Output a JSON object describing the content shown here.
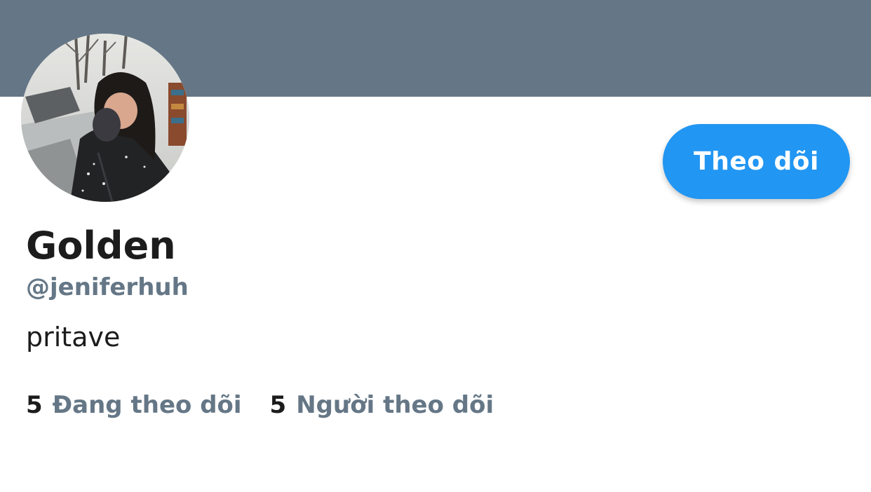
{
  "profile": {
    "display_name": "Golden",
    "handle": "@jeniferhuh",
    "bio": "pritave",
    "follow_label": "Theo dõi"
  },
  "stats": {
    "following_count": "5",
    "following_label": "Đang theo dõi",
    "followers_count": "5",
    "followers_label": "Người theo dõi"
  },
  "colors": {
    "banner": "#657786",
    "accent": "#2196f3",
    "secondary_text": "#657786",
    "primary_text": "#1c1c1c"
  }
}
